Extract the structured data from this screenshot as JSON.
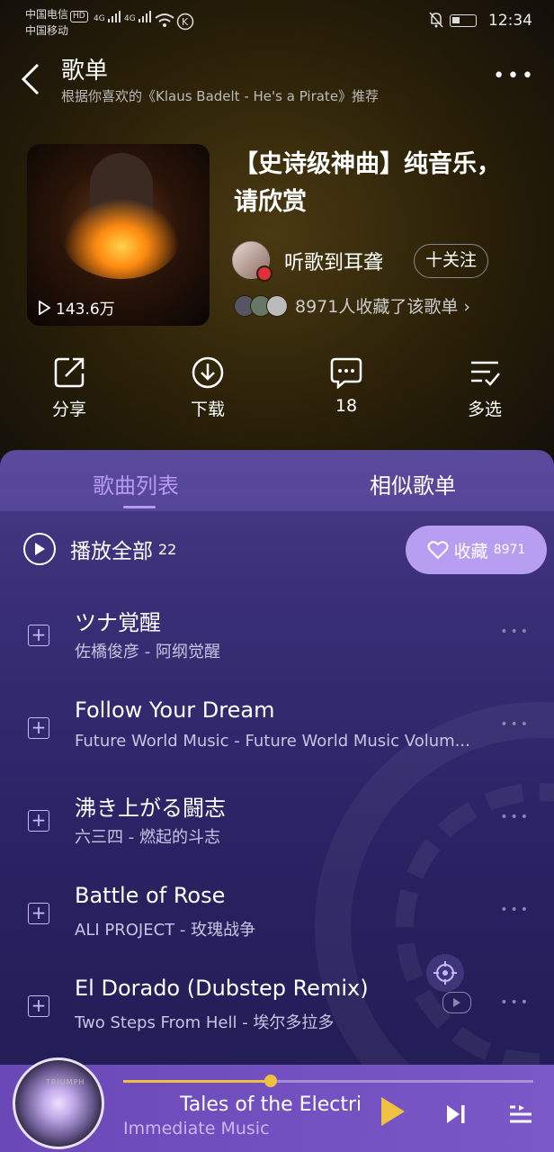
{
  "status_bar": {
    "carrier1": "中国电信",
    "carrier1_badge": "HD",
    "carrier2": "中国移动",
    "net1": "4G",
    "net2": "4G",
    "time": "12:34"
  },
  "header": {
    "title": "歌单",
    "subtitle": "根据你喜欢的《Klaus Badelt - He's a Pirate》推荐",
    "more_label": "•••"
  },
  "playlist": {
    "play_count": "143.6万",
    "name": "【史诗级神曲】纯音乐，请欣赏",
    "creator": "听歌到耳聋",
    "follow_label": "十关注",
    "favorites_text": "8971人收藏了该歌单 ›"
  },
  "actions": {
    "share": "分享",
    "download": "下载",
    "comment": "18",
    "multi_select": "多选"
  },
  "tabs": [
    {
      "label": "歌曲列表",
      "active": true
    },
    {
      "label": "相似歌单",
      "active": false
    }
  ],
  "play_all": {
    "label": "播放全部",
    "count": "22"
  },
  "collect_button": {
    "label": "收藏",
    "count": "8971"
  },
  "songs": [
    {
      "title": "ツナ覚醒",
      "subtitle": "佐橋俊彦 - 阿纲觉醒"
    },
    {
      "title": "Follow Your Dream",
      "subtitle": "Future World Music - Future World Music Volum..."
    },
    {
      "title": "沸き上がる闘志",
      "subtitle": "六三四 - 燃起的斗志"
    },
    {
      "title": "Battle of Rose",
      "subtitle": "ALI PROJECT - 玫瑰战争"
    },
    {
      "title": "El Dorado (Dubstep Remix)",
      "subtitle": "Two Steps From Hell - 埃尔多拉多"
    }
  ],
  "now_playing": {
    "title": "Tales of the Electric",
    "artist": "Immediate Music",
    "album_art_text": "TRIUMPH",
    "progress": 0.36
  },
  "colors": {
    "accent": "#b79af0",
    "panel": "#2a2365",
    "player": "#7356c2",
    "progress": "#f0c040"
  }
}
